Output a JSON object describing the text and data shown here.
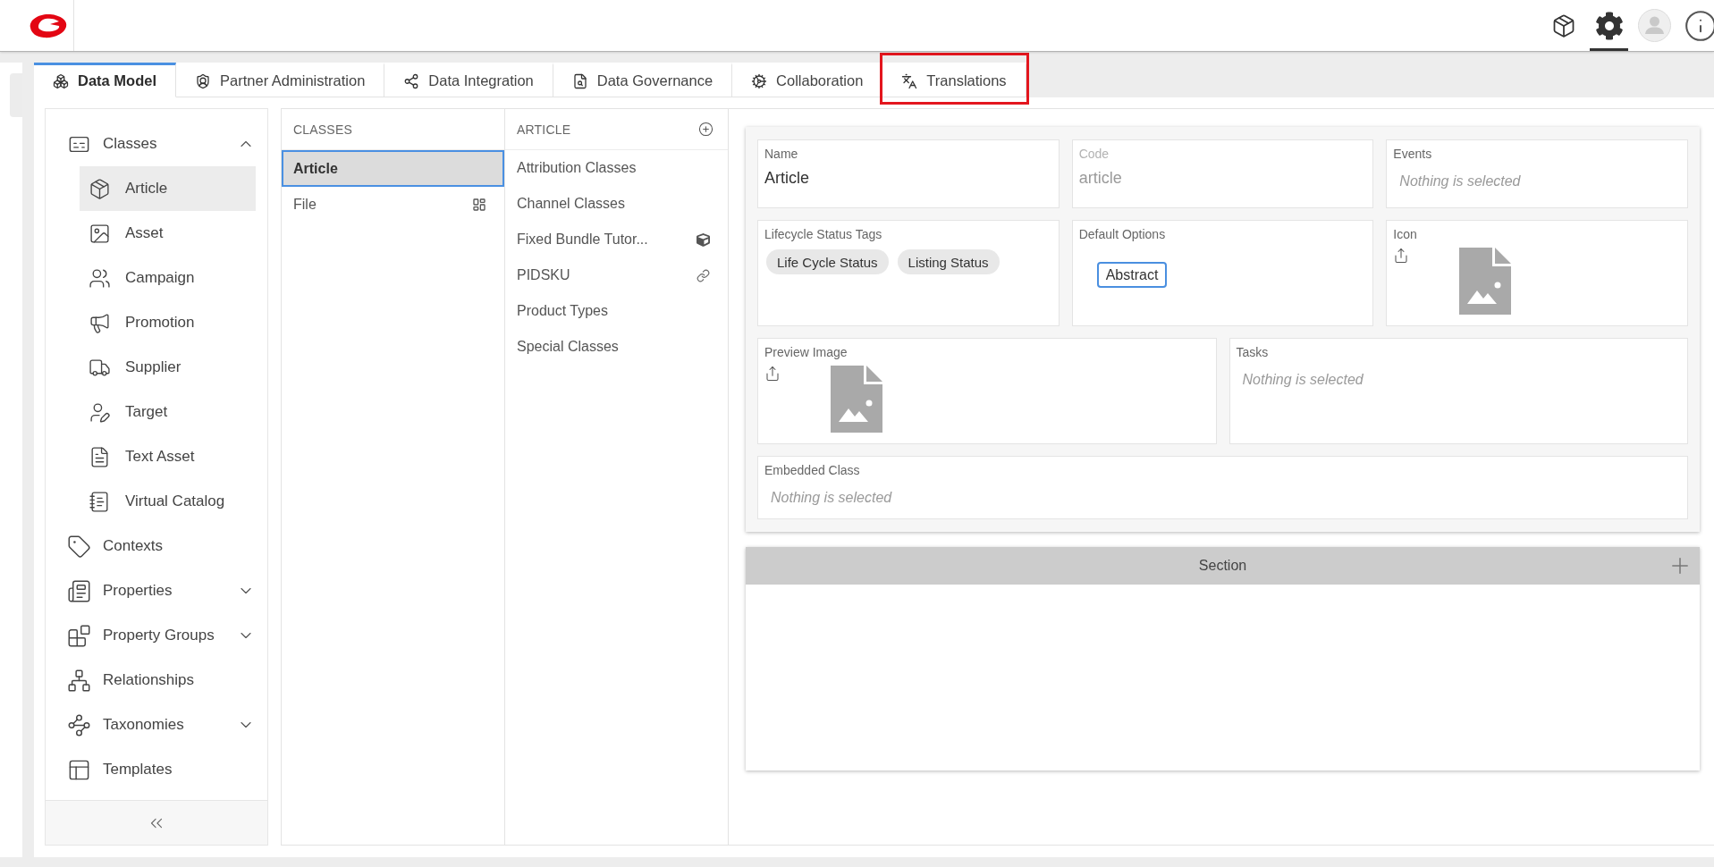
{
  "toolbar": [
    {
      "kind": "package",
      "selected": false
    },
    {
      "kind": "settings",
      "selected": true
    },
    {
      "kind": "avatar",
      "selected": false
    },
    {
      "kind": "info",
      "selected": false
    }
  ],
  "tabs": [
    {
      "label": "Data Model",
      "kind": "data-model",
      "selected": true,
      "highlighted": false
    },
    {
      "label": "Partner Administration",
      "kind": "partner",
      "selected": false,
      "highlighted": false
    },
    {
      "label": "Data Integration",
      "kind": "integration",
      "selected": false,
      "highlighted": false
    },
    {
      "label": "Data Governance",
      "kind": "governance",
      "selected": false,
      "highlighted": false
    },
    {
      "label": "Collaboration",
      "kind": "collaboration",
      "selected": false,
      "highlighted": false
    },
    {
      "label": "Translations",
      "kind": "translations",
      "selected": false,
      "highlighted": true
    }
  ],
  "sidebar": {
    "items": [
      {
        "label": "Classes",
        "kind": "classes",
        "selected": false,
        "expanded": true,
        "children": [
          {
            "label": "Article",
            "kind": "article",
            "selected": true
          },
          {
            "label": "Asset",
            "kind": "asset",
            "selected": false
          },
          {
            "label": "Campaign",
            "kind": "campaign",
            "selected": false
          },
          {
            "label": "Promotion",
            "kind": "promotion",
            "selected": false
          },
          {
            "label": "Supplier",
            "kind": "supplier",
            "selected": false
          },
          {
            "label": "Target",
            "kind": "target",
            "selected": false
          },
          {
            "label": "Text Asset",
            "kind": "text-asset",
            "selected": false
          },
          {
            "label": "Virtual Catalog",
            "kind": "catalog",
            "selected": false
          }
        ]
      },
      {
        "label": "Contexts",
        "kind": "contexts",
        "selected": false
      },
      {
        "label": "Properties",
        "kind": "properties",
        "selected": false,
        "expanded": false
      },
      {
        "label": "Property Groups",
        "kind": "property-groups",
        "selected": false,
        "expanded": false
      },
      {
        "label": "Relationships",
        "kind": "relationships",
        "selected": false
      },
      {
        "label": "Taxonomies",
        "kind": "taxonomies",
        "selected": false,
        "expanded": false
      },
      {
        "label": "Templates",
        "kind": "templates",
        "selected": false
      }
    ]
  },
  "classes": {
    "header": "CLASSES",
    "items": [
      {
        "label": "Article",
        "kind": "plain",
        "selected": true
      },
      {
        "label": "File",
        "kind": "file",
        "selected": false
      }
    ]
  },
  "article": {
    "header": "ARTICLE",
    "items": [
      {
        "label": "Attribution Classes",
        "kind": "plain",
        "selected": false
      },
      {
        "label": "Channel Classes",
        "kind": "plain",
        "selected": false
      },
      {
        "label": "Fixed Bundle Tutor...",
        "kind": "bundle",
        "selected": false
      },
      {
        "label": "PIDSKU",
        "kind": "linked",
        "selected": false
      },
      {
        "label": "Product Types",
        "kind": "plain",
        "selected": false
      },
      {
        "label": "Special Classes",
        "kind": "plain",
        "selected": false
      }
    ]
  },
  "detail": {
    "rows": [
      {
        "fields": [
          {
            "label": "Name",
            "kind": "text",
            "value": "Article",
            "disabled": false
          },
          {
            "label": "Code",
            "kind": "text",
            "value": "article",
            "disabled": true
          },
          {
            "label": "Events",
            "kind": "select",
            "placeholder": "Nothing is selected"
          }
        ]
      },
      {
        "fields": [
          {
            "label": "Lifecycle Status Tags",
            "kind": "tags",
            "tags": [
              "Life Cycle Status",
              "Listing Status"
            ]
          },
          {
            "label": "Default Options",
            "kind": "options",
            "options": [
              {
                "label": "Abstract",
                "selected": true
              }
            ]
          },
          {
            "label": "Icon",
            "kind": "image"
          }
        ]
      },
      {
        "fields": [
          {
            "label": "Preview Image",
            "kind": "image"
          },
          {
            "label": "Tasks",
            "kind": "select",
            "placeholder": "Nothing is selected"
          }
        ]
      },
      {
        "fields": [
          {
            "label": "Embedded Class",
            "kind": "select",
            "placeholder": "Nothing is selected"
          }
        ]
      }
    ]
  },
  "section": {
    "title": "Section"
  }
}
